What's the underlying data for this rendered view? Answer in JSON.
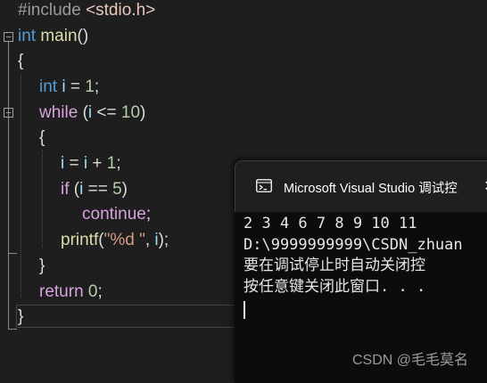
{
  "editor": {
    "lines": [
      {
        "tokens": [
          {
            "t": "#include",
            "c": "inc"
          },
          {
            "t": " ",
            "c": "punc"
          },
          {
            "t": "<stdio.h>",
            "c": "incf"
          }
        ]
      },
      {
        "tokens": [
          {
            "t": "int",
            "c": "kw"
          },
          {
            "t": " ",
            "c": "punc"
          },
          {
            "t": "main",
            "c": "fn"
          },
          {
            "t": "()",
            "c": "punc"
          }
        ]
      },
      {
        "tokens": [
          {
            "t": "{",
            "c": "punc"
          }
        ]
      },
      {
        "tokens": [
          {
            "t": "int",
            "c": "kw"
          },
          {
            "t": " ",
            "c": "punc"
          },
          {
            "t": "i",
            "c": "var"
          },
          {
            "t": " = ",
            "c": "punc"
          },
          {
            "t": "1",
            "c": "num"
          },
          {
            "t": ";",
            "c": "punc"
          }
        ]
      },
      {
        "tokens": [
          {
            "t": "while",
            "c": "kw2"
          },
          {
            "t": " (",
            "c": "punc"
          },
          {
            "t": "i",
            "c": "var"
          },
          {
            "t": " <= ",
            "c": "punc"
          },
          {
            "t": "10",
            "c": "num"
          },
          {
            "t": ")",
            "c": "punc"
          }
        ]
      },
      {
        "tokens": [
          {
            "t": "{",
            "c": "punc"
          }
        ]
      },
      {
        "tokens": [
          {
            "t": "i",
            "c": "var"
          },
          {
            "t": " = ",
            "c": "punc"
          },
          {
            "t": "i",
            "c": "var"
          },
          {
            "t": " + ",
            "c": "punc"
          },
          {
            "t": "1",
            "c": "num"
          },
          {
            "t": ";",
            "c": "punc"
          }
        ]
      },
      {
        "tokens": [
          {
            "t": "if",
            "c": "kw2"
          },
          {
            "t": " (",
            "c": "punc"
          },
          {
            "t": "i",
            "c": "var"
          },
          {
            "t": " == ",
            "c": "punc"
          },
          {
            "t": "5",
            "c": "num"
          },
          {
            "t": ")",
            "c": "punc"
          }
        ]
      },
      {
        "tokens": [
          {
            "t": "continue",
            "c": "kw2"
          },
          {
            "t": ";",
            "c": "punc"
          }
        ]
      },
      {
        "tokens": [
          {
            "t": "printf",
            "c": "fn"
          },
          {
            "t": "(",
            "c": "punc"
          },
          {
            "t": "\"%d \"",
            "c": "str"
          },
          {
            "t": ", ",
            "c": "punc"
          },
          {
            "t": "i",
            "c": "var"
          },
          {
            "t": ");",
            "c": "punc"
          }
        ]
      },
      {
        "tokens": [
          {
            "t": "}",
            "c": "punc"
          }
        ]
      },
      {
        "tokens": [
          {
            "t": "return",
            "c": "kw2"
          },
          {
            "t": " ",
            "c": "punc"
          },
          {
            "t": "0",
            "c": "num"
          },
          {
            "t": ";",
            "c": "punc"
          }
        ]
      },
      {
        "tokens": [
          {
            "t": "}",
            "c": "punc"
          }
        ]
      }
    ]
  },
  "console": {
    "title": "Microsoft Visual Studio 调试控",
    "close_glyph": "✕",
    "icon": "console-app-icon",
    "lines": [
      "2 3 4 6 7 8 9 10 11",
      "D:\\9999999999\\CSDN_zhuan",
      "要在调试停止时自动关闭控",
      "按任意键关闭此窗口. . ."
    ]
  },
  "watermark": "CSDN @毛毛莫名",
  "colors": {
    "editor_bg": "#1e1e1e",
    "console_bg": "#0c0c0c",
    "titlebar_bg": "#1f1f1f",
    "keyword": "#569cd6",
    "control_keyword": "#d8a0df",
    "function": "#dcdcaa",
    "variable": "#9cdcfe",
    "number": "#b5cea8",
    "string": "#d69d85"
  }
}
